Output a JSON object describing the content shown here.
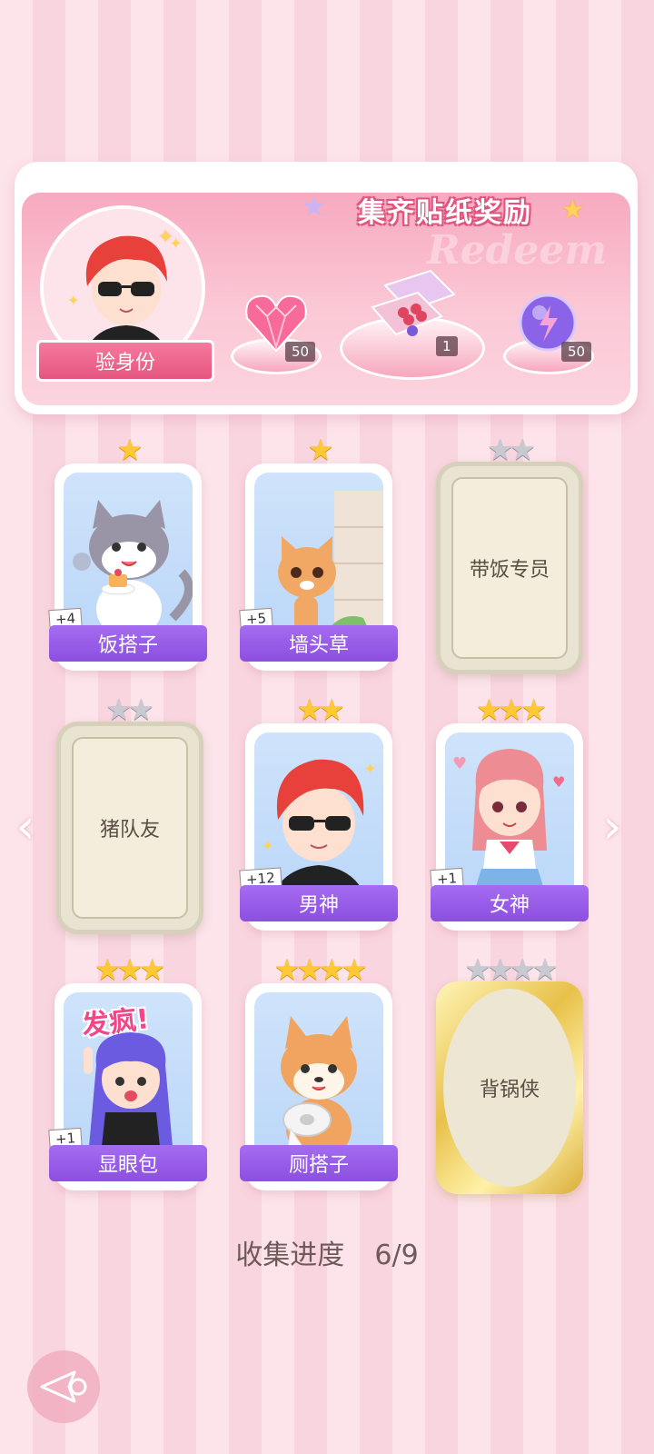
{
  "banner": {
    "title": "集齐贴纸奖励",
    "watermark": "Redeem",
    "verify_label": "验身份",
    "rewards": [
      {
        "icon": "heart-gem-icon",
        "count": "50"
      },
      {
        "icon": "gift-box-icon",
        "count": "1"
      },
      {
        "icon": "lightning-orb-icon",
        "count": "50"
      }
    ]
  },
  "cards": [
    {
      "name": "饭搭子",
      "stars": 1,
      "max_stars": 1,
      "status": "collected",
      "plus": "+4",
      "art": "cat-with-cake"
    },
    {
      "name": "墙头草",
      "stars": 1,
      "max_stars": 1,
      "status": "collected",
      "plus": "+5",
      "art": "cat-peeking-wall"
    },
    {
      "name": "带饭专员",
      "stars": 0,
      "max_stars": 2,
      "status": "locked"
    },
    {
      "name": "猪队友",
      "stars": 0,
      "max_stars": 2,
      "status": "locked"
    },
    {
      "name": "男神",
      "stars": 2,
      "max_stars": 2,
      "status": "collected",
      "plus": "+12",
      "art": "boy-sunglasses"
    },
    {
      "name": "女神",
      "stars": 3,
      "max_stars": 3,
      "status": "collected",
      "plus": "+1",
      "art": "girl-sailor"
    },
    {
      "name": "显眼包",
      "stars": 3,
      "max_stars": 3,
      "status": "collected",
      "plus": "+1",
      "art": "girl-crazy",
      "art_text": "发疯!"
    },
    {
      "name": "厕搭子",
      "stars": 4,
      "max_stars": 4,
      "status": "collected",
      "art": "shiba-toilet-paper"
    },
    {
      "name": "背锅侠",
      "stars": 0,
      "max_stars": 4,
      "status": "locked-gold"
    }
  ],
  "progress": {
    "label": "收集进度",
    "value": "6/9"
  },
  "nav": {
    "prev": "‹",
    "next": "›"
  }
}
